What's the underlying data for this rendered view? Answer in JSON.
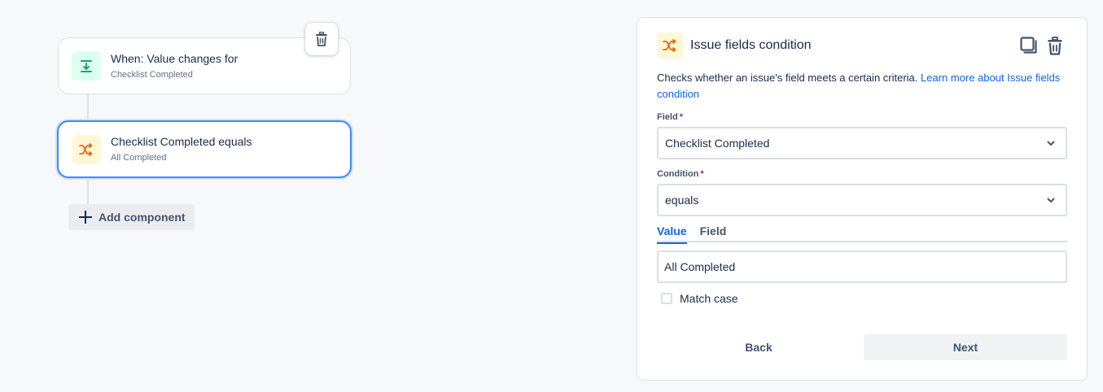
{
  "flow": {
    "trigger": {
      "title": "When: Value changes for",
      "subtitle": "Checklist Completed",
      "icon": "value-change-icon"
    },
    "condition": {
      "title": "Checklist Completed equals",
      "subtitle": "All Completed",
      "icon": "branch-icon"
    },
    "add_component_label": "Add component",
    "delete_icon": "trash-icon"
  },
  "panel": {
    "title": "Issue fields condition",
    "description": "Checks whether an issue's field meets a certain criteria.",
    "learn_more_link": "Learn more about Issue fields condition",
    "field_label": "Field",
    "field_value": "Checklist Completed",
    "condition_label": "Condition",
    "condition_value": "equals",
    "required_marker": "*",
    "tabs": [
      {
        "label": "Value",
        "active": true
      },
      {
        "label": "Field",
        "active": false
      }
    ],
    "value_input": "All Completed",
    "match_case_label": "Match case",
    "match_case_checked": false,
    "back_label": "Back",
    "next_label": "Next",
    "header_actions": [
      "copy-icon",
      "trash-icon"
    ]
  },
  "colors": {
    "accent_blue": "#0c66e4",
    "selected_border": "#388bff",
    "trigger_icon_bg": "#dcfff1",
    "trigger_icon_fg": "#22a06b",
    "condition_icon_bg": "#fff7d6",
    "condition_icon_fg": "#e56910"
  }
}
